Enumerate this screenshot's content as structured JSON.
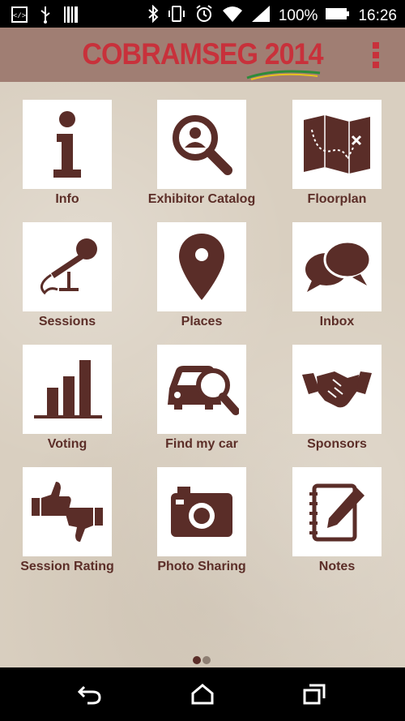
{
  "status_bar": {
    "battery_percent": "100%",
    "time": "16:26",
    "icons": [
      "code-icon",
      "usb-icon",
      "barcode-icon",
      "bluetooth-icon",
      "vibrate-icon",
      "alarm-icon",
      "wifi-icon",
      "signal-icon",
      "battery-icon"
    ]
  },
  "app_bar": {
    "logo_text": "COBRAMSEG 2014",
    "menu_icon": "overflow-menu-icon",
    "colors": {
      "bar": "#a07e73",
      "logo": "#c8313b"
    }
  },
  "grid": {
    "icon_color": "#5a2d28",
    "label_color": "#5c2e28",
    "tiles": [
      {
        "label": "Info",
        "icon": "info-icon"
      },
      {
        "label": "Exhibitor Catalog",
        "icon": "magnifier-person-icon"
      },
      {
        "label": "Floorplan",
        "icon": "treasure-map-icon"
      },
      {
        "label": "Sessions",
        "icon": "microphone-icon"
      },
      {
        "label": "Places",
        "icon": "map-pin-icon"
      },
      {
        "label": "Inbox",
        "icon": "chat-bubbles-icon"
      },
      {
        "label": "Voting",
        "icon": "bar-chart-icon"
      },
      {
        "label": "Find my car",
        "icon": "car-search-icon"
      },
      {
        "label": "Sponsors",
        "icon": "handshake-icon"
      },
      {
        "label": "Session Rating",
        "icon": "thumbs-up-down-icon"
      },
      {
        "label": "Photo Sharing",
        "icon": "camera-icon"
      },
      {
        "label": "Notes",
        "icon": "notepad-pen-icon"
      }
    ]
  },
  "pager": {
    "pages": 2,
    "current": 1
  },
  "nav_bar": {
    "icons": [
      "back-icon",
      "home-icon",
      "recents-icon"
    ]
  }
}
